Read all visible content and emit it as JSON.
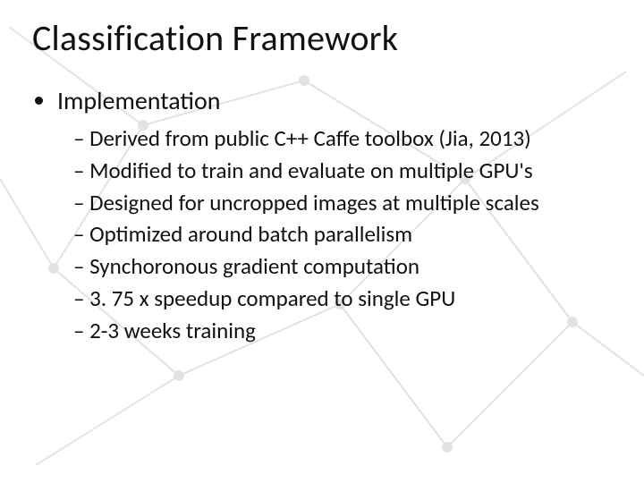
{
  "title": "Classification Framework",
  "bullets": {
    "l1": "Implementation",
    "l2": [
      "Derived from public C++ Caffe toolbox (Jia, 2013)",
      "Modified to train and evaluate on multiple GPU's",
      "Designed for uncropped images at multiple scales",
      "Optimized around batch parallelism",
      "Synchoronous gradient computation",
      "3. 75 x speedup compared to single GPU",
      "2-3 weeks training"
    ]
  }
}
